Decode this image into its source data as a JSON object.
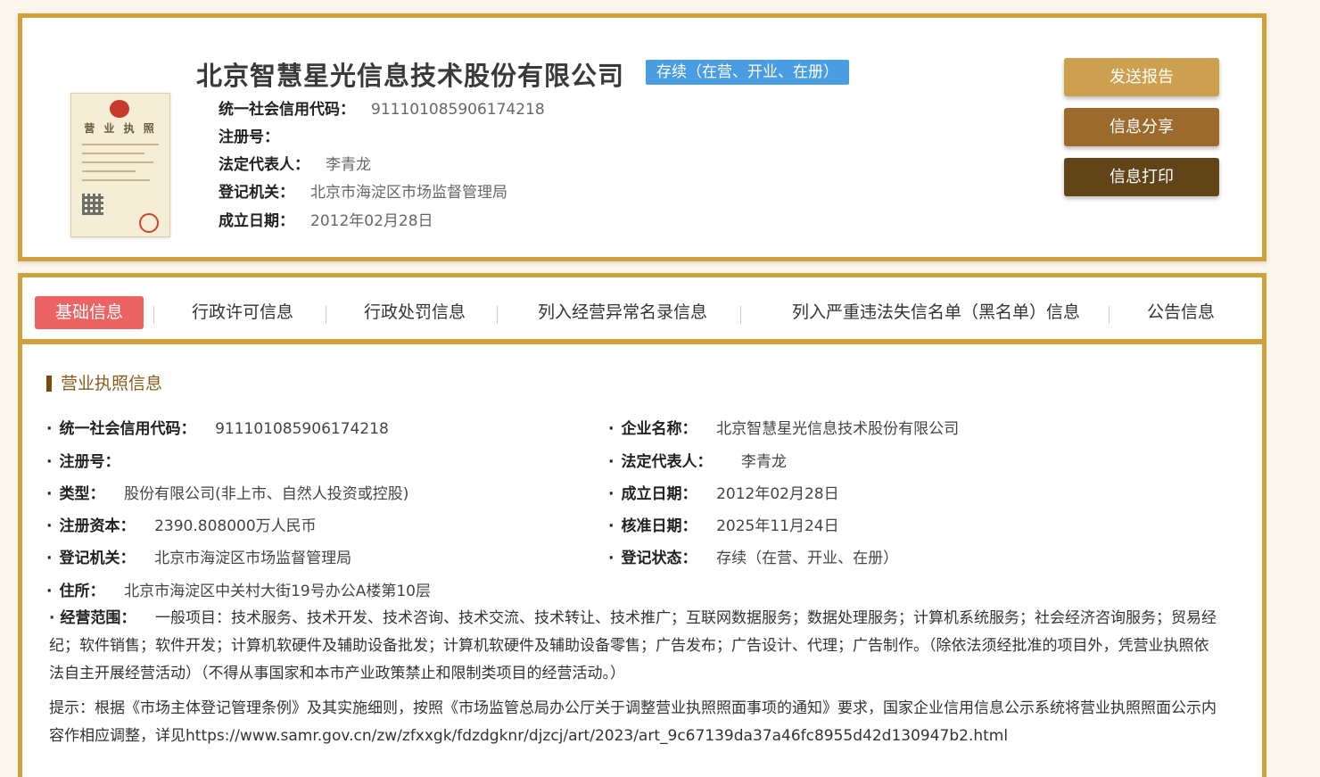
{
  "header": {
    "company_name": "北京智慧星光信息技术股份有限公司",
    "status": "存续（在营、开业、在册）",
    "license_thumb_title": "营 业 执 照",
    "credit_code_label": "统一社会信用代码：",
    "credit_code": "911101085906174218",
    "reg_no_label": "注册号：",
    "reg_no": "",
    "legal_rep_label": "法定代表人：",
    "legal_rep": "李青龙",
    "authority_label": "登记机关：",
    "authority": "北京市海淀区市场监督管理局",
    "founded_label": "成立日期：",
    "founded": "2012年02月28日"
  },
  "actions": {
    "send_report": "发送报告",
    "share": "信息分享",
    "print": "信息打印"
  },
  "tabs": [
    {
      "label": "基础信息",
      "active": true
    },
    {
      "label": "行政许可信息"
    },
    {
      "label": "行政处罚信息"
    },
    {
      "label": "列入经营异常名录信息"
    },
    {
      "label": "列入严重违法失信名单（黑名单）信息"
    },
    {
      "label": "公告信息"
    }
  ],
  "details": {
    "section_title": "营业执照信息",
    "credit_code": {
      "label": "统一社会信用代码：",
      "value": "911101085906174218"
    },
    "company_name": {
      "label": "企业名称：",
      "value": "北京智慧星光信息技术股份有限公司"
    },
    "reg_no": {
      "label": "注册号：",
      "value": ""
    },
    "legal_rep": {
      "label": "法定代表人：",
      "value": "李青龙"
    },
    "type": {
      "label": "类型：",
      "value": "股份有限公司(非上市、自然人投资或控股)"
    },
    "founded": {
      "label": "成立日期：",
      "value": "2012年02月28日"
    },
    "capital": {
      "label": "注册资本：",
      "value": "2390.808000万人民币"
    },
    "approved": {
      "label": "核准日期：",
      "value": "2025年11月24日"
    },
    "authority": {
      "label": "登记机关：",
      "value": "北京市海淀区市场监督管理局"
    },
    "reg_status": {
      "label": "登记状态：",
      "value": "存续（在营、开业、在册）"
    },
    "address": {
      "label": "住所：",
      "value": "北京市海淀区中关村大街19号办公A楼第10层"
    },
    "scope": {
      "label": "经营范围：",
      "value": "一般项目：技术服务、技术开发、技术咨询、技术交流、技术转让、技术推广；互联网数据服务；数据处理服务；计算机系统服务；社会经济咨询服务；贸易经纪；软件销售；软件开发；计算机软硬件及辅助设备批发；计算机软硬件及辅助设备零售；广告发布；广告设计、代理；广告制作。（除依法须经批准的项目外，凭营业执照依法自主开展经营活动）（不得从事国家和本市产业政策禁止和限制类项目的经营活动。）"
    },
    "note": "提示：根据《市场主体登记管理条例》及其实施细则，按照《市场监管总局办公厅关于调整营业执照照面事项的通知》要求，国家企业信用信息公示系统将营业执照照面公示内容作相应调整，详见https://www.samr.gov.cn/zw/zfxxgk/fdzdgknr/djzcj/art/2023/art_9c67139da37a46fc8955d42d130947b2.html"
  }
}
